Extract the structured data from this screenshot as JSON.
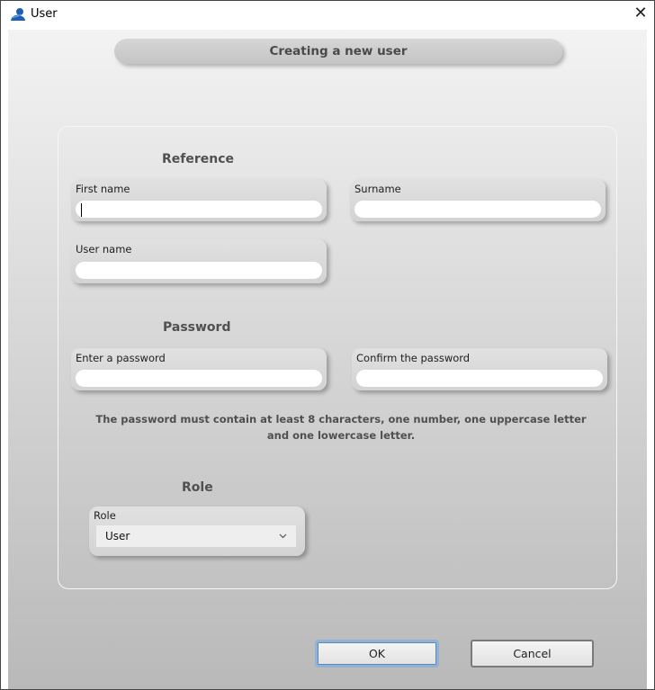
{
  "window": {
    "title": "User",
    "close_symbol": "✕"
  },
  "header": {
    "title": "Creating a new user"
  },
  "reference": {
    "section_title": "Reference",
    "first_name": {
      "label": "First name",
      "value": ""
    },
    "surname": {
      "label": "Surname",
      "value": ""
    },
    "user_name": {
      "label": "User name",
      "value": ""
    }
  },
  "password": {
    "section_title": "Password",
    "enter": {
      "label": "Enter a password",
      "value": ""
    },
    "confirm": {
      "label": "Confirm the password",
      "value": ""
    },
    "hint_line1": "The password must contain at least 8 characters, one number, one uppercase letter",
    "hint_line2": "and one lowercase letter."
  },
  "role": {
    "section_title": "Role",
    "label": "Role",
    "selected": "User"
  },
  "buttons": {
    "ok": "OK",
    "cancel": "Cancel"
  },
  "icons": {
    "app": "user-app-icon",
    "close": "close-icon",
    "dropdown": "chevron-down-icon"
  },
  "colors": {
    "icon_blue": "#1e5fb4",
    "ok_border": "#8fb2d6"
  }
}
